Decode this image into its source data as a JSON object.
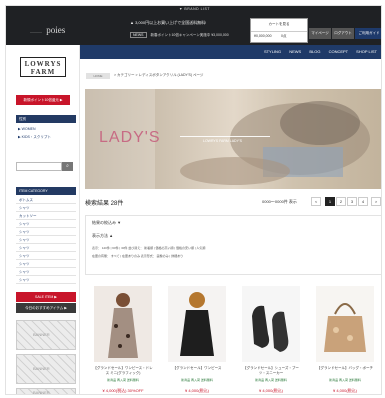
{
  "top_strip": "▼ BRAND LIST",
  "header": {
    "logo_prefix": "———",
    "logo_text": "poies",
    "promo_line_1": "▲ 3,000円以上お買い上げで全国送料無料!",
    "promo_tag": "NEWS",
    "promo_line_2": "新春ポイント10倍キャンペーン実施中",
    "promo_amount": "¥3,000,000",
    "cart_label": "カートを見る",
    "cart_total": "¥0,000,000",
    "cart_items": "0点",
    "btn_1": "マイページ",
    "btn_2": "ログアウト",
    "btn_3": "ご利用ガイド"
  },
  "sidebar": {
    "brand_line_1": "LOWRYS",
    "brand_line_2": "FARM",
    "point_button": "新規ポイント10倍還元 ▶",
    "gender_head": "性別",
    "gender_items": [
      "▶ WOMEN",
      "▶ KIDS・スクリプト"
    ],
    "search_icon": "⌕",
    "category_head": "ITEM CATEGORY",
    "categories": [
      "ボトムス",
      "シャツ",
      "カットソー",
      "シャツ",
      "シャツ",
      "シャツ",
      "シャツ",
      "シャツ",
      "シャツ",
      "シャツ",
      "シャツ"
    ],
    "sale_button": "SALE ITEM ▶",
    "coord_button": "今日のおすすめアイテム ▶",
    "banners": [
      "BANNER",
      "BANNER",
      "BANNER"
    ]
  },
  "nav": {
    "items": [
      "STYLING",
      "NEWS",
      "BLOG",
      "CONCEPT",
      "SHOP LIST"
    ]
  },
  "breadcrumb": {
    "home": "HOME",
    "trail": "> カテゴリー > レディスボタンアクリル (LADY'S) ページ"
  },
  "hero": {
    "title": "LADY'S",
    "subtitle": "LOWRYS FARM LADY'S"
  },
  "results": {
    "label": "検索結果 28件",
    "range": "0000〜0000件 表示",
    "prev": "<",
    "pages": [
      "1",
      "2",
      "3",
      "4"
    ],
    "next": ">"
  },
  "filters": {
    "refine_label": "結果の絞込み ▼",
    "display_label": "表示方法 ▲",
    "line_1": "表示： 120件 | 60件 | 30件   並び替え： 新着順 | 価格の高い順 | 価格の安い順 | 人気順",
    "line_2": "在庫の有無： すべて | 在庫ありのみ   表示形式： 画像のみ | 詳細あり"
  },
  "products": [
    {
      "title": "【グランドセール】ワンピース・ドレス ミニ(グラフィック)",
      "badge": "新商品 再入荷 送料無料",
      "price": "¥ 4,000(税込) 30%OFF"
    },
    {
      "title": "【グランドセール】ワンピース",
      "badge": "新商品 再入荷 送料無料",
      "price": "¥ 4,000(税込)"
    },
    {
      "title": "【グランドセール】シューズ・ブーツ・スニーカー",
      "badge": "新商品 再入荷 送料無料",
      "price": "¥ 4,000(税込)"
    },
    {
      "title": "【グランドセール】バッグ・ポーチ",
      "badge": "新商品 再入荷 送料無料",
      "price": "¥ 4,000(税込)"
    }
  ],
  "colors": {
    "navy": "#1f3a68",
    "red": "#c8152a",
    "dark": "#1f2124"
  }
}
